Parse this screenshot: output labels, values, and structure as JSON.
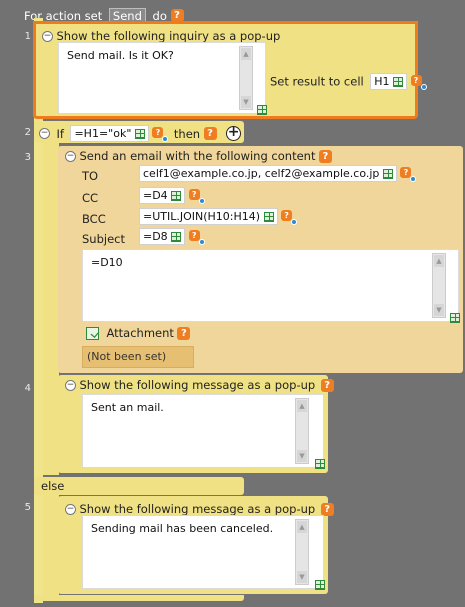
{
  "header": {
    "prefix": "For action set",
    "keyword": "Send",
    "suffix": "do",
    "help": "?"
  },
  "line_numbers": [
    "1",
    "2",
    "3",
    "4",
    "5"
  ],
  "step1": {
    "title": "Show the following inquiry as a pop-up",
    "message": "Send mail. Is it OK?",
    "result_label": "Set result to cell",
    "result_cell": "H1"
  },
  "step2": {
    "if_label": "If",
    "condition": "=H1=\"ok\"",
    "then_label": "then"
  },
  "step3": {
    "title": "Send an email with the following content",
    "to_label": "TO",
    "to_value": "celf1@example.co.jp, celf2@example.co.jp",
    "cc_label": "CC",
    "cc_value": "=D4",
    "bcc_label": "BCC",
    "bcc_value": "=UTIL.JOIN(H10:H14)",
    "subject_label": "Subject",
    "subject_value": "=D8",
    "body": "=D10",
    "attachment_label": "Attachment",
    "attachment_status": "(Not been set)"
  },
  "step4": {
    "title": "Show the following message as a pop-up",
    "message": "Sent an mail."
  },
  "else_label": "else",
  "step5": {
    "title": "Show the following message as a pop-up",
    "message": "Sending mail has been canceled."
  },
  "icons": {
    "help": "help-icon",
    "collapse": "collapse-icon",
    "cell_select": "cell-select-icon",
    "formula": "formula-help-icon",
    "add": "add-icon",
    "attachment": "attachment-icon"
  },
  "colors": {
    "background": "#727272",
    "block_yellow": "#f0e184",
    "block_tan": "#f0d69a",
    "selected_border": "#f07b1d",
    "help_orange": "#ef7d22"
  }
}
